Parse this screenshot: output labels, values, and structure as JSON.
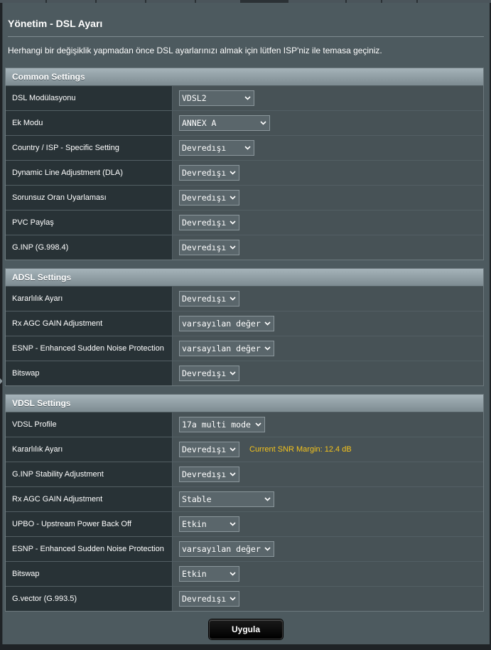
{
  "page": {
    "title": "Yönetim - DSL Ayarı",
    "intro": "Herhangi bir değişiklik yapmadan önce DSL ayarlarınızı almak için lütfen ISP'niz ile temasa geçiniz."
  },
  "icons": {
    "dropdown": "chevron-down-icon"
  },
  "colors": {
    "snr_text": "#f4c31c",
    "panel": "#4d5a5f",
    "label_cell": "#283236"
  },
  "common": {
    "header": "Common Settings",
    "rows": [
      {
        "label": "DSL Modülasyonu",
        "value": "VDSL2"
      },
      {
        "label": "Ek Modu",
        "value": "ANNEX A"
      },
      {
        "label": "Country / ISP - Specific Setting",
        "value": "Devredışı"
      },
      {
        "label": "Dynamic Line Adjustment (DLA)",
        "value": "Devredışı"
      },
      {
        "label": "Sorunsuz Oran Uyarlaması",
        "value": "Devredışı"
      },
      {
        "label": "PVC Paylaş",
        "value": "Devredışı"
      },
      {
        "label": "G.INP (G.998.4)",
        "value": "Devredışı"
      }
    ]
  },
  "adsl": {
    "header": "ADSL Settings",
    "rows": [
      {
        "label": "Kararlılık Ayarı",
        "value": "Devredışı"
      },
      {
        "label": "Rx AGC GAIN Adjustment",
        "value": "varsayılan değer"
      },
      {
        "label": "ESNP - Enhanced Sudden Noise Protection",
        "value": "varsayılan değer"
      },
      {
        "label": "Bitswap",
        "value": "Devredışı"
      }
    ]
  },
  "vdsl": {
    "header": "VDSL Settings",
    "rows": [
      {
        "label": "VDSL Profile",
        "value": "17a multi mode"
      },
      {
        "label": "Kararlılık Ayarı",
        "value": "Devredışı",
        "note": "Current SNR Margin: 12.4 dB"
      },
      {
        "label": "G.INP Stability Adjustment",
        "value": "Devredışı"
      },
      {
        "label": "Rx AGC GAIN Adjustment",
        "value": "Stable"
      },
      {
        "label": "UPBO - Upstream Power Back Off",
        "value": "Etkin"
      },
      {
        "label": "ESNP - Enhanced Sudden Noise Protection",
        "value": "varsayılan değer"
      },
      {
        "label": "Bitswap",
        "value": "Etkin"
      },
      {
        "label": "G.vector (G.993.5)",
        "value": "Devredışı"
      }
    ]
  },
  "actions": {
    "apply": "Uygula"
  }
}
